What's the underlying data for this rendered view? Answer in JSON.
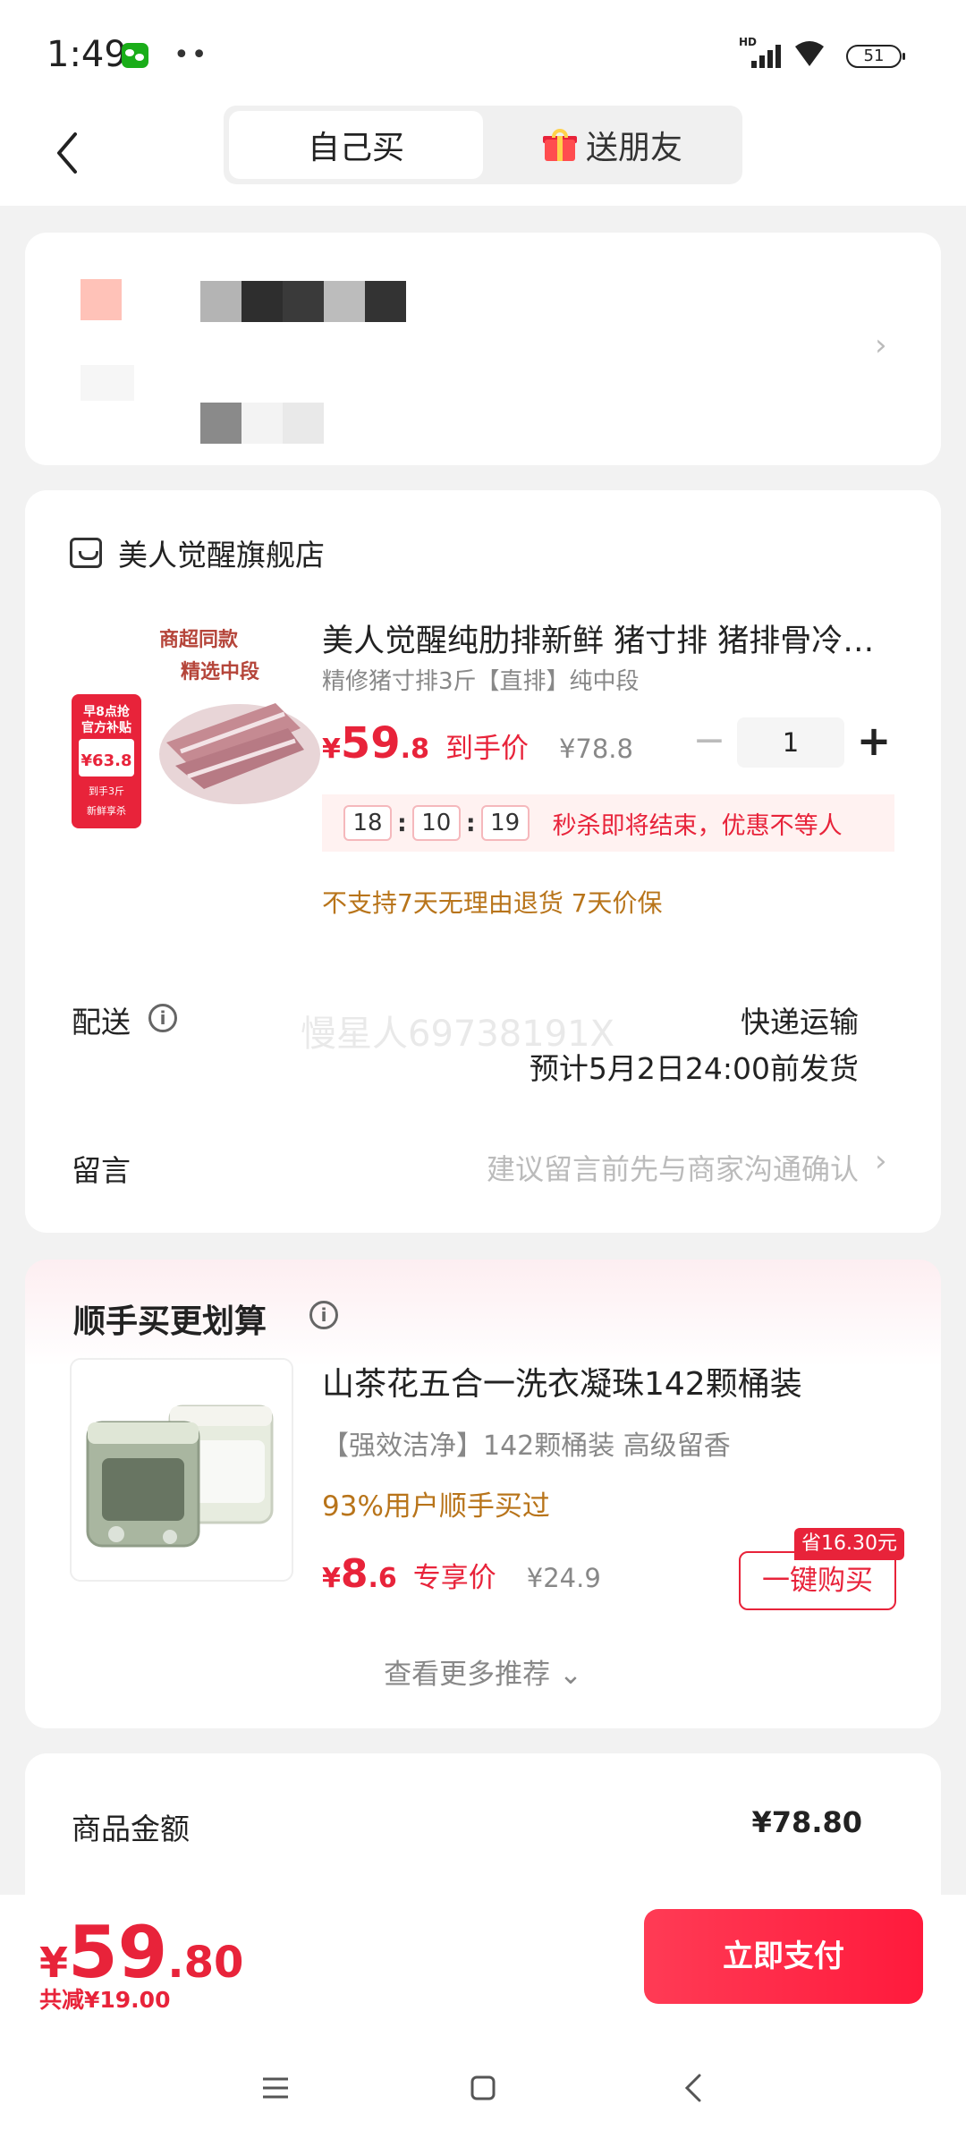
{
  "status_bar": {
    "time": "1:49",
    "battery": "51",
    "network": "HD"
  },
  "nav": {
    "tabs": [
      {
        "label": "自己买"
      },
      {
        "label": "送朋友"
      }
    ]
  },
  "store": {
    "name": "美人觉醒旗舰店"
  },
  "product": {
    "title": "美人觉醒纯肋排新鲜 猪寸排 猪排骨冷冻冷冻",
    "spec": "精修猪寸排3斤【直排】纯中段",
    "price_symbol": "¥",
    "price_int": "59",
    "price_dec": ".8",
    "price_label": "到手价",
    "original_price": "¥78.8",
    "quantity": "1",
    "image_text": {
      "tag1": "商超同款",
      "tag2": "精选中段",
      "badge_title": "早8点抢",
      "badge_sub": "官方补贴",
      "badge_price": "¥63.8",
      "badge_note1": "到手3斤",
      "badge_note2": "新鲜享杀"
    }
  },
  "flash_sale": {
    "hours": "18",
    "minutes": "10",
    "seconds": "19",
    "text": "秒杀即将结束，优惠不等人"
  },
  "policy": "不支持7天无理由退货  7天价保",
  "delivery": {
    "label": "配送",
    "method": "快递运输",
    "eta": "预计5月2日24:00前发货",
    "watermark": "慢星人69738191X"
  },
  "message": {
    "label": "留言",
    "placeholder": "建议留言前先与商家沟通确认"
  },
  "recommend": {
    "title": "顺手买更划算",
    "name": "山茶花五合一洗衣凝珠142颗桶装",
    "spec": "【强效洁净】142颗桶装 高级留香",
    "buyers": "93%用户顺手买过",
    "price_symbol": "¥",
    "price_int": "8",
    "price_dec": ".6",
    "price_label": "专享价",
    "original_price": "¥24.9",
    "save_badge": "省16.30元",
    "buy_label": "一键购买",
    "more_label": "查看更多推荐"
  },
  "summary": {
    "goods_label": "商品金额",
    "goods_value": "¥78.80"
  },
  "bottom": {
    "symbol": "¥",
    "total_int": "59",
    "total_dec": ".80",
    "discount": "共减¥19.00",
    "pay_label": "立即支付"
  },
  "colors": {
    "accent": "#e8233a",
    "warning": "#b8741a"
  }
}
